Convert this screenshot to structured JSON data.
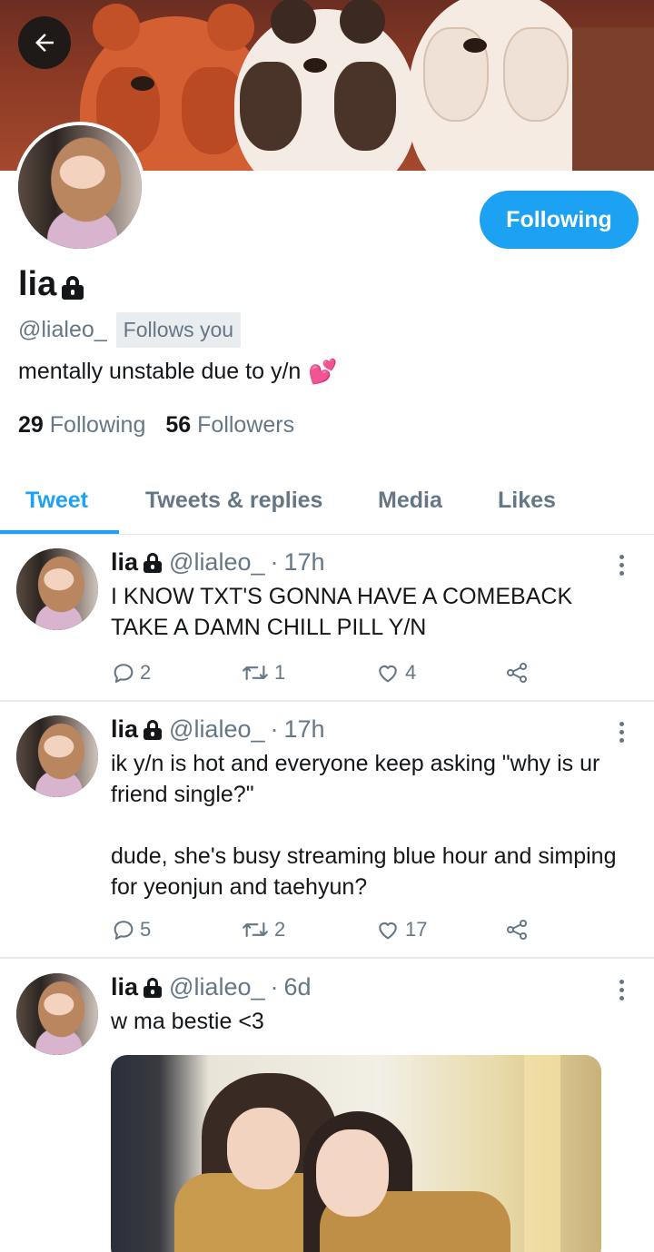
{
  "profile": {
    "name": "lia",
    "handle": "@lialeo_",
    "follows_you": "Follows you",
    "bio": "mentally unstable due to y/n",
    "bio_emoji": "💕",
    "following_count": "29",
    "following_label": "Following",
    "followers_count": "56",
    "followers_label": "Followers",
    "follow_button": "Following"
  },
  "tabs": [
    {
      "label": "Tweet",
      "active": true
    },
    {
      "label": "Tweets & replies",
      "active": false
    },
    {
      "label": "Media",
      "active": false
    },
    {
      "label": "Likes",
      "active": false
    }
  ],
  "tweets": [
    {
      "name": "lia",
      "handle": "@lialeo_",
      "dot": "·",
      "time": "17h",
      "text": "I KNOW TXT'S GONNA HAVE A COMEBACK TAKE A DAMN CHILL PILL Y/N",
      "replies": "2",
      "retweets": "1",
      "likes": "4"
    },
    {
      "name": "lia",
      "handle": "@lialeo_",
      "dot": "·",
      "time": "17h",
      "text": "ik y/n is hot and everyone keep asking \"why is ur friend single?\"\n\ndude, she's busy streaming blue hour and simping for yeonjun and taehyun?",
      "replies": "5",
      "retweets": "2",
      "likes": "17"
    },
    {
      "name": "lia",
      "handle": "@lialeo_",
      "dot": "·",
      "time": "6d",
      "text": "w ma bestie <3"
    }
  ],
  "colors": {
    "accent": "#1da1f2",
    "text": "#14171a",
    "secondary": "#657786"
  },
  "icons": {
    "back": "arrow-left-icon",
    "lock": "lock-icon",
    "more": "more-vertical-icon",
    "reply": "reply-icon",
    "retweet": "retweet-icon",
    "like": "heart-icon",
    "share": "share-icon"
  }
}
